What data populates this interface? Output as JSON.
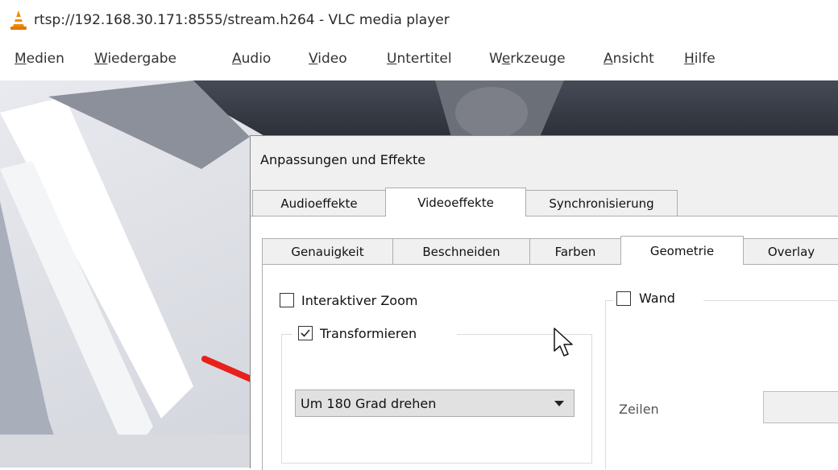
{
  "window": {
    "title": "rtsp://192.168.30.171:8555/stream.h264 - VLC media player",
    "icon": "vlc-cone-icon"
  },
  "menu": [
    {
      "acc": "M",
      "rest": "edien"
    },
    {
      "acc": "W",
      "rest": "iedergabe"
    },
    {
      "acc": "A",
      "rest": "udio"
    },
    {
      "acc": "V",
      "rest": "ideo"
    },
    {
      "acc": "U",
      "rest": "ntertitel"
    },
    {
      "pre": "W",
      "acc": "e",
      "rest": "rkzeuge"
    },
    {
      "acc": "A",
      "rest": "nsicht"
    },
    {
      "acc": "H",
      "rest": "ilfe"
    }
  ],
  "dialog": {
    "title": "Anpassungen und Effekte",
    "tabs": [
      "Audioeffekte",
      "Videoeffekte",
      "Synchronisierung"
    ],
    "active_tab": "Videoeffekte",
    "subtabs": [
      "Genauigkeit",
      "Beschneiden",
      "Farben",
      "Geometrie",
      "Overlay"
    ],
    "active_subtab": "Geometrie",
    "interactive_zoom": {
      "label": "Interaktiver Zoom",
      "checked": false
    },
    "transform": {
      "label": "Transformieren",
      "checked": true,
      "selected": "Um 180 Grad drehen"
    },
    "wall": {
      "label": "Wand",
      "checked": false,
      "rows_label": "Zeilen"
    }
  },
  "colors": {
    "annotation_arrow": "#e8201c",
    "vlc_orange": "#f48b00"
  }
}
